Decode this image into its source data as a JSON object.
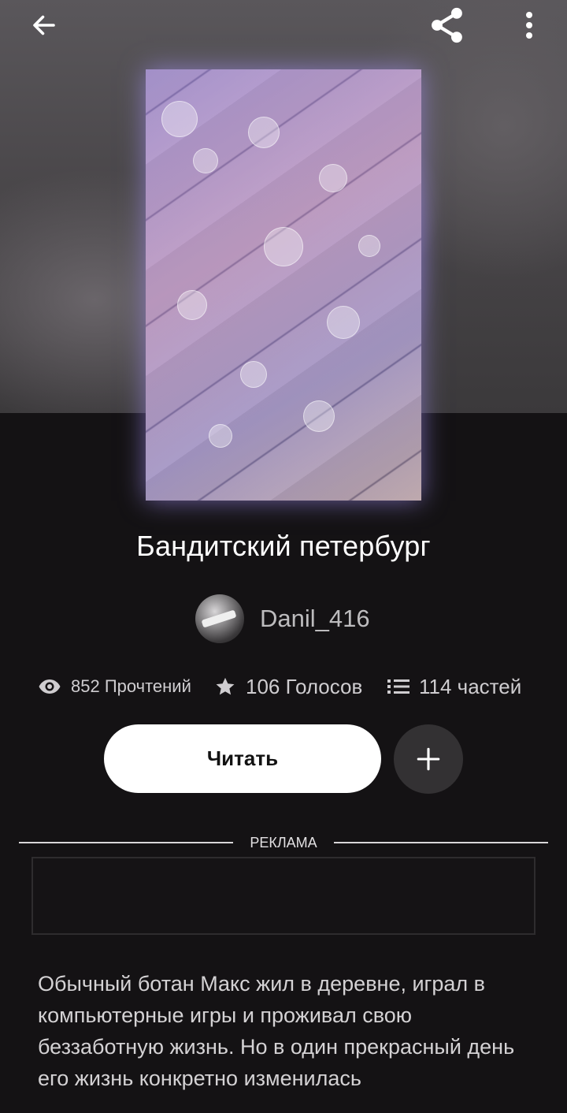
{
  "header": {
    "back_icon": "arrow-left-icon",
    "share_icon": "share-icon",
    "more_icon": "more-vertical-icon"
  },
  "story": {
    "title": "Бандитский петербург",
    "author": "Danil_416",
    "stats": {
      "views": "852 Прочтений",
      "votes": "106 Голосов",
      "parts": "114 частей"
    },
    "read_label": "Читать",
    "description": "Обычный ботан Макс жил в деревне, играл в компьютерные игры и проживал свою беззаботную жизнь. Но в один прекрасный день его жизнь конкретно изменилась"
  },
  "ad": {
    "label": "РЕКЛАМА"
  },
  "colors": {
    "background": "#141214",
    "button_primary": "#ffffff",
    "button_secondary": "#333133",
    "text_secondary": "#cfcdd0"
  }
}
